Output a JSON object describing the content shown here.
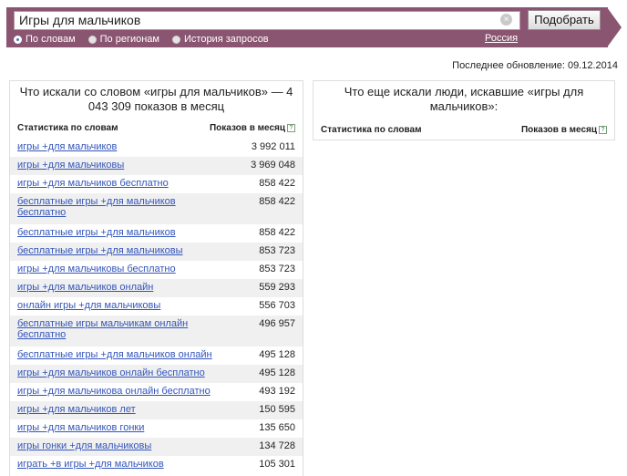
{
  "search": {
    "query": "Игры для мальчиков",
    "button": "Подобрать",
    "clear_icon": "×",
    "modes": [
      "По словам",
      "По регионам",
      "История запросов"
    ],
    "region": "Россия"
  },
  "last_update": "Последнее обновление: 09.12.2014",
  "left_panel": {
    "title": "Что искали со словом «игры для мальчиков» — 4 043 309 показов в месяц",
    "col_words": "Статистика по словам",
    "col_count": "Показов в месяц",
    "rows": [
      {
        "keyword": "игры +для мальчиков",
        "count": "3 992 011"
      },
      {
        "keyword": "игры +для мальчиковы",
        "count": "3 969 048"
      },
      {
        "keyword": "игры +для мальчиков бесплатно",
        "count": "858 422"
      },
      {
        "keyword": "бесплатные игры +для мальчиков бесплатно",
        "count": "858 422"
      },
      {
        "keyword": "бесплатные игры +для мальчиков",
        "count": "858 422"
      },
      {
        "keyword": "бесплатные игры +для мальчиковы",
        "count": "853 723"
      },
      {
        "keyword": "игры +для мальчиковы бесплатно",
        "count": "853 723"
      },
      {
        "keyword": "игры +для мальчиков онлайн",
        "count": "559 293"
      },
      {
        "keyword": "онлайн игры +для мальчиковы",
        "count": "556 703"
      },
      {
        "keyword": "бесплатные игры мальчикам онлайн бесплатно",
        "count": "496 957"
      },
      {
        "keyword": "бесплатные игры +для мальчиков онлайн",
        "count": "495 128"
      },
      {
        "keyword": "игры +для мальчиков онлайн бесплатно",
        "count": "495 128"
      },
      {
        "keyword": "игры +для мальчикова онлайн бесплатно",
        "count": "493 192"
      },
      {
        "keyword": "игры +для мальчиков лет",
        "count": "150 595"
      },
      {
        "keyword": "игры +для мальчиков гонки",
        "count": "135 650"
      },
      {
        "keyword": "игры гонки +для мальчиковы",
        "count": "134 728"
      },
      {
        "keyword": "играть +в игры +для мальчиков",
        "count": "105 301"
      }
    ]
  },
  "right_panel": {
    "title": "Что еще искали люди, искавшие «игры для мальчиков»:",
    "col_words": "Статистика по словам",
    "col_count": "Показов в месяц"
  }
}
